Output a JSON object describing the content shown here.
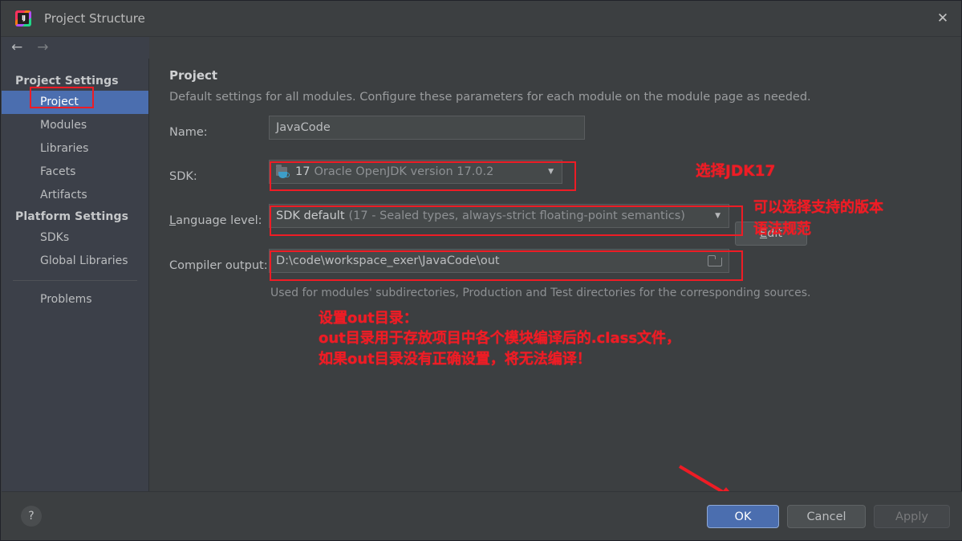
{
  "window": {
    "title": "Project Structure",
    "icon": "intellij-idea-icon",
    "close_label": "✕"
  },
  "nav": {
    "back": "←",
    "forward": "→"
  },
  "sidebar": {
    "groups": [
      {
        "label": "Project Settings"
      },
      {
        "label": "Platform Settings"
      }
    ],
    "items": [
      {
        "label": "Project",
        "selected": true
      },
      {
        "label": "Modules",
        "selected": false
      },
      {
        "label": "Libraries",
        "selected": false
      },
      {
        "label": "Facets",
        "selected": false
      },
      {
        "label": "Artifacts",
        "selected": false
      },
      {
        "label": "SDKs",
        "selected": false
      },
      {
        "label": "Global Libraries",
        "selected": false
      },
      {
        "label": "Problems",
        "selected": false
      }
    ]
  },
  "main": {
    "title": "Project",
    "subtitle": "Default settings for all modules. Configure these parameters for each module on the module page as needed.",
    "name": {
      "label": "Name:",
      "value": "JavaCode"
    },
    "sdk": {
      "label": "SDK:",
      "value_strong": "17",
      "value_rest": "Oracle OpenJDK version 17.0.2",
      "arrow": "▼",
      "edit_button_prefix": "E",
      "edit_button_rest": "dit"
    },
    "language_level": {
      "label_prefix": "L",
      "label_rest": "anguage level:",
      "value_strong": "SDK default",
      "value_rest": "(17 - Sealed types, always-strict floating-point semantics)",
      "arrow": "▼"
    },
    "compiler_output": {
      "label": "Compiler output:",
      "value": "D:\\code\\workspace_exer\\JavaCode\\out",
      "browse_icon": "folder-icon",
      "hint": "Used for modules' subdirectories, Production and Test directories for the corresponding sources."
    }
  },
  "annotations": {
    "color": "#ee1c25",
    "sdk_note": "选择JDK17",
    "language_note_line1": "可以选择支持的版本",
    "language_note_line2": "语法规范",
    "out_note_line1": "设置out目录：",
    "out_note_line2": "out目录用于存放项目中各个模块编译后的.class文件，",
    "out_note_line3": "如果out目录没有正确设置，将无法编译！"
  },
  "footer": {
    "help": "?",
    "ok": "OK",
    "cancel": "Cancel",
    "apply": "Apply"
  }
}
